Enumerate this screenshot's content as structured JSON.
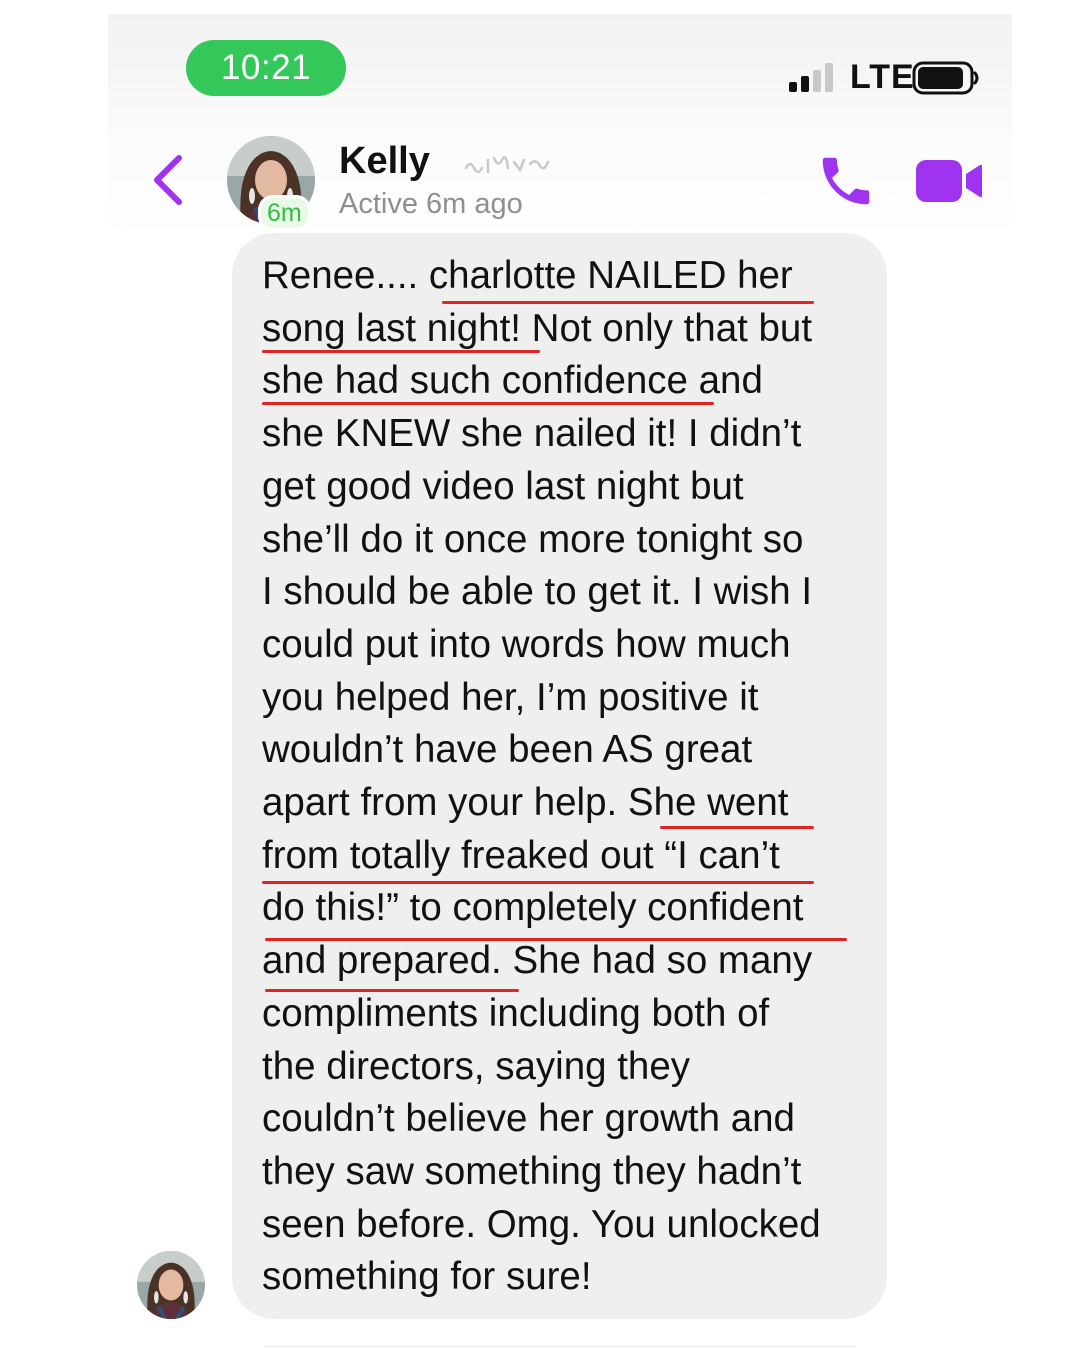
{
  "status_bar": {
    "time": "10:21",
    "network": "LTE",
    "signal_bars_active": 2,
    "signal_bars_total": 4,
    "battery_level": 0.9,
    "time_pill_color": "#34c759"
  },
  "header": {
    "back_icon": "chevron-left-icon",
    "contact_name": "Kelly",
    "active_badge": "6m",
    "active_status": "Active 6m ago",
    "call_icon": "phone-icon",
    "video_icon": "video-camera-icon",
    "accent_color": "#a033f0"
  },
  "conversation": {
    "messages": [
      {
        "from": "Kelly",
        "lines": [
          "Renee.... charlotte NAILED her",
          "song last night! Not only that but",
          "she had such confidence and",
          "she KNEW she nailed it! I didn’t",
          "get good video last night but",
          "she’ll do it once more tonight so",
          "I should be able to get it. I wish I",
          "could put into words how much",
          "you helped her, I’m positive it",
          "wouldn’t have been AS great",
          "apart from your help. She went",
          "from totally freaked out “I can’t",
          "do this!” to completely confident",
          "and prepared. She had so many",
          "compliments including both of",
          "the directors, saying they",
          "couldn’t believe her growth and",
          "they saw something they hadn’t",
          "seen before. Omg. You unlocked",
          "something for sure!"
        ]
      }
    ],
    "bubble_color": "#efefef",
    "highlight_underline_color": "#e02424"
  }
}
